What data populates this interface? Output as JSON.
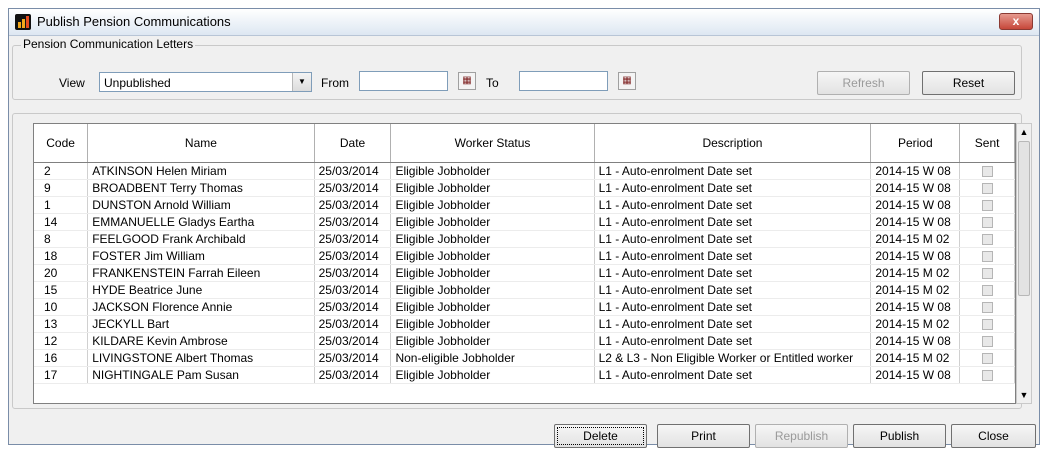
{
  "window": {
    "title": "Publish Pension Communications",
    "close_glyph": "x"
  },
  "filters": {
    "group_label": "Pension Communication Letters",
    "view_label": "View",
    "view_value": "Unpublished",
    "from_label": "From",
    "from_value": "",
    "to_label": "To",
    "to_value": ""
  },
  "buttons": {
    "refresh": "Refresh",
    "reset": "Reset",
    "delete": "Delete",
    "print": "Print",
    "republish": "Republish",
    "publish": "Publish",
    "close": "Close"
  },
  "table": {
    "columns": [
      "Code",
      "Name",
      "Date",
      "Worker Status",
      "Description",
      "Period",
      "Sent"
    ],
    "rows": [
      [
        "2",
        "ATKINSON Helen Miriam",
        "25/03/2014",
        "Eligible Jobholder",
        "L1 - Auto-enrolment Date set",
        "2014-15 W 08"
      ],
      [
        "9",
        "BROADBENT Terry Thomas",
        "25/03/2014",
        "Eligible Jobholder",
        "L1 - Auto-enrolment Date set",
        "2014-15 W 08"
      ],
      [
        "1",
        "DUNSTON Arnold William",
        "25/03/2014",
        "Eligible Jobholder",
        "L1 - Auto-enrolment Date set",
        "2014-15 W 08"
      ],
      [
        "14",
        "EMMANUELLE Gladys Eartha",
        "25/03/2014",
        "Eligible Jobholder",
        "L1 - Auto-enrolment Date set",
        "2014-15 W 08"
      ],
      [
        "8",
        "FEELGOOD Frank Archibald",
        "25/03/2014",
        "Eligible Jobholder",
        "L1 - Auto-enrolment Date set",
        "2014-15 M 02"
      ],
      [
        "18",
        "FOSTER Jim William",
        "25/03/2014",
        "Eligible Jobholder",
        "L1 - Auto-enrolment Date set",
        "2014-15 W 08"
      ],
      [
        "20",
        "FRANKENSTEIN Farrah Eileen",
        "25/03/2014",
        "Eligible Jobholder",
        "L1 - Auto-enrolment Date set",
        "2014-15 M 02"
      ],
      [
        "15",
        "HYDE Beatrice June",
        "25/03/2014",
        "Eligible Jobholder",
        "L1 - Auto-enrolment Date set",
        "2014-15 M 02"
      ],
      [
        "10",
        "JACKSON Florence Annie",
        "25/03/2014",
        "Eligible Jobholder",
        "L1 - Auto-enrolment Date set",
        "2014-15 W 08"
      ],
      [
        "13",
        "JECKYLL Bart",
        "25/03/2014",
        "Eligible Jobholder",
        "L1 - Auto-enrolment Date set",
        "2014-15 M 02"
      ],
      [
        "12",
        "KILDARE Kevin Ambrose",
        "25/03/2014",
        "Eligible Jobholder",
        "L1 - Auto-enrolment Date set",
        "2014-15 W 08"
      ],
      [
        "16",
        "LIVINGSTONE Albert Thomas",
        "25/03/2014",
        "Non-eligible Jobholder",
        "L2 & L3 - Non Eligible Worker or Entitled worker",
        "2014-15 M 02"
      ],
      [
        "17",
        "NIGHTINGALE Pam Susan",
        "25/03/2014",
        "Eligible Jobholder",
        "L1 - Auto-enrolment Date set",
        "2014-15 W 08"
      ]
    ]
  },
  "icons": {
    "app": "app-chart-icon",
    "calendar": "calendar-icon",
    "dropdown": "chevron-down-icon",
    "scroll_up": "scroll-up-icon",
    "scroll_down": "scroll-down-icon"
  }
}
